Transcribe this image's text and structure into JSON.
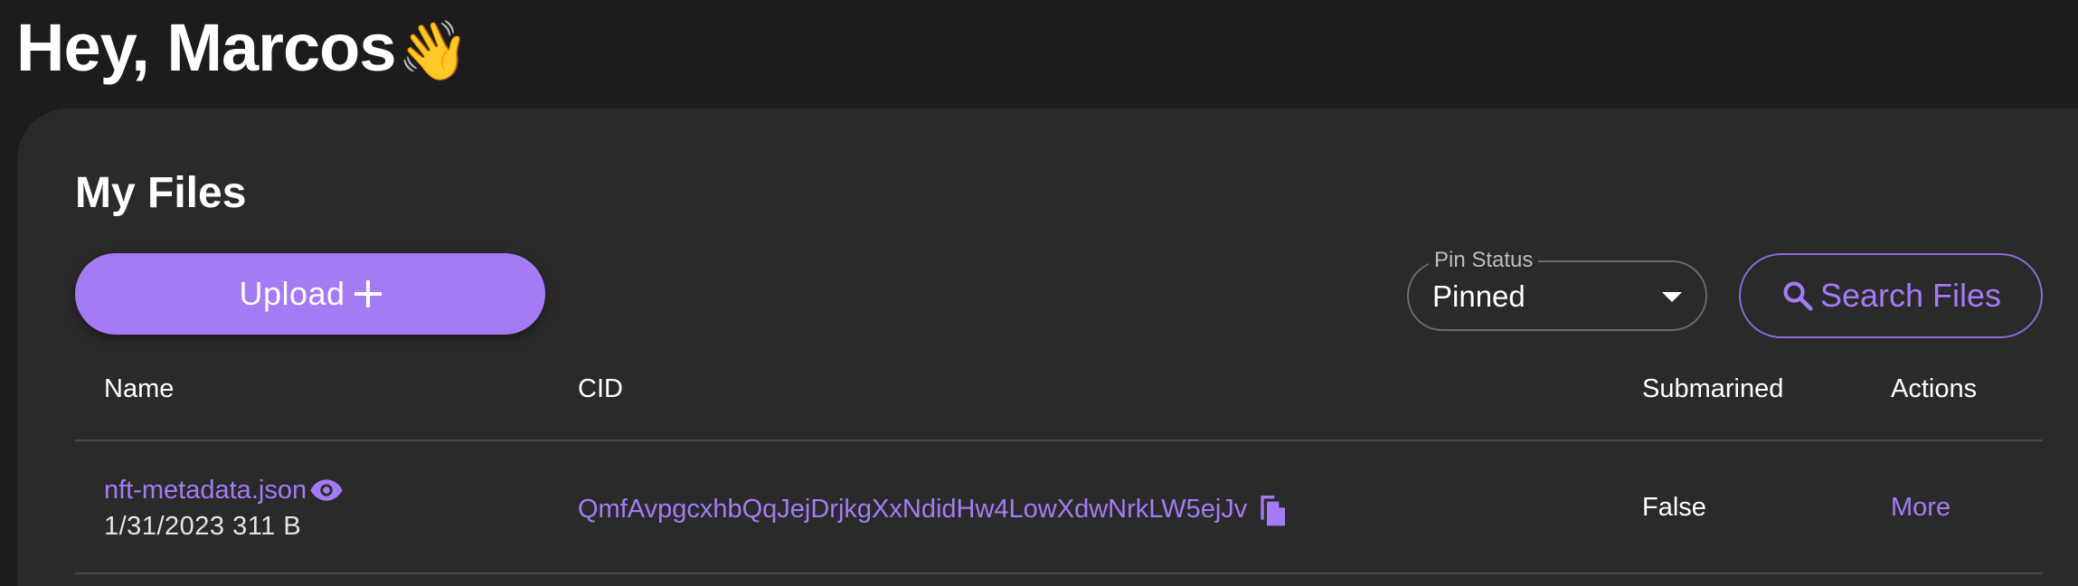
{
  "header": {
    "greeting": "Hey, Marcos",
    "wave_emoji": "👋"
  },
  "files_section": {
    "title": "My Files",
    "upload_label": "Upload",
    "pin_status": {
      "legend": "Pin Status",
      "selected": "Pinned"
    },
    "search_label": "Search Files"
  },
  "table": {
    "columns": [
      "Name",
      "CID",
      "Submarined",
      "Actions"
    ],
    "rows": [
      {
        "name": "nft-metadata.json",
        "meta": "1/31/2023 311 B",
        "cid": "QmfAvpgcxhbQqJejDrjkgXxNdidHw4LowXdwNrkLW5ejJv",
        "submarined": "False",
        "action": "More"
      }
    ]
  },
  "colors": {
    "accent": "#a57bf5",
    "background": "#1c1c1c",
    "card": "#2a2a2a"
  },
  "icons": [
    "wave-emoji",
    "plus-icon",
    "chevron-down-icon",
    "search-icon",
    "eye-icon",
    "copy-icon"
  ]
}
